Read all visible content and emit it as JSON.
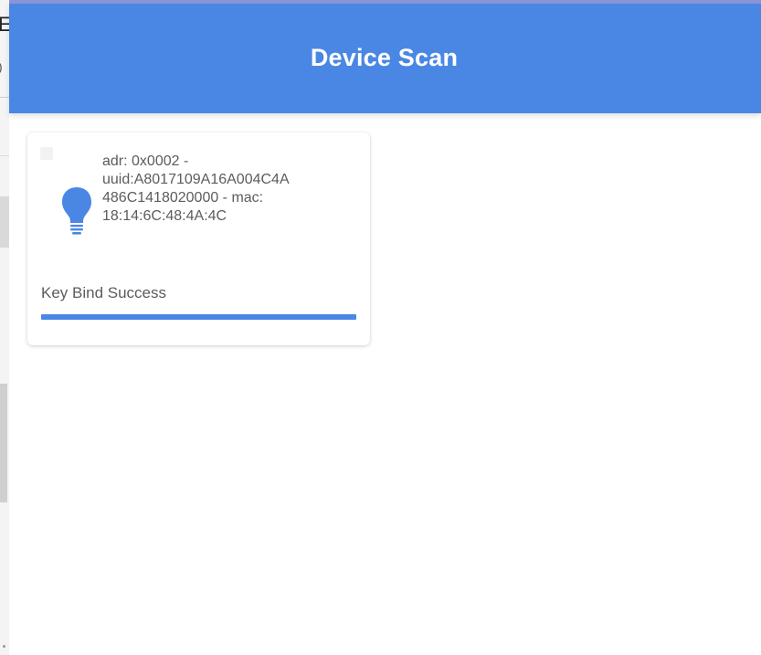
{
  "app": {
    "title": "Device Scan",
    "accent_color": "#4a87e5"
  },
  "device_card": {
    "icon": "bulb-icon",
    "info_lines": [
      "adr: 0x0002 -",
      "uuid:A8017109A16A004C4A",
      "486C1418020000 - mac:",
      "18:14:6C:48:4A:4C"
    ],
    "status": "Key Bind Success",
    "progress": 1.0
  },
  "background_window": {
    "title_fragment": "E",
    "subtitle_fragment": ")"
  }
}
